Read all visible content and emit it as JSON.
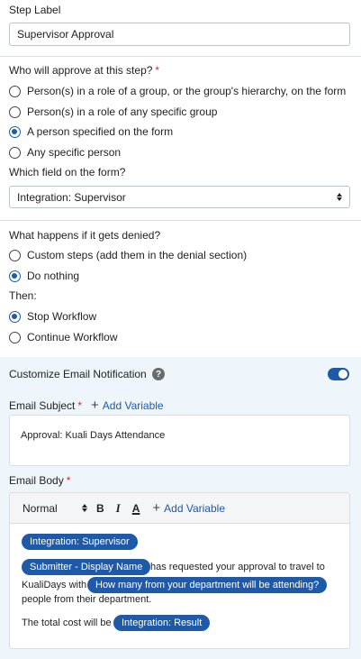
{
  "step_label": {
    "label": "Step Label",
    "value": "Supervisor Approval"
  },
  "approver": {
    "question": "Who will approve at this step?",
    "required_mark": "*",
    "options": [
      {
        "label": "Person(s) in a role of a group, or the group's hierarchy, on the form",
        "selected": false
      },
      {
        "label": "Person(s) in a role of any specific group",
        "selected": false
      },
      {
        "label": "A person specified on the form",
        "selected": true
      },
      {
        "label": "Any specific person",
        "selected": false
      }
    ],
    "field_question": "Which field on the form?",
    "field_value": "Integration: Supervisor"
  },
  "denial": {
    "question": "What happens if it gets denied?",
    "options": [
      {
        "label": "Custom steps (add them in the denial section)",
        "selected": false
      },
      {
        "label": "Do nothing",
        "selected": true
      }
    ],
    "then_label": "Then:",
    "then_options": [
      {
        "label": "Stop Workflow",
        "selected": true
      },
      {
        "label": "Continue Workflow",
        "selected": false
      }
    ]
  },
  "email": {
    "customize_label": "Customize Email Notification",
    "help_glyph": "?",
    "toggle_on": true,
    "subject_label": "Email Subject",
    "required_mark": "*",
    "add_variable": "Add Variable",
    "subject_value": "Approval: Kuali Days Attendance",
    "body_label": "Email Body",
    "toolbar": {
      "format": "Normal",
      "bold": "B",
      "italic": "I",
      "underline": "A",
      "add_variable": "Add Variable"
    },
    "body": {
      "pill_supervisor": "Integration: Supervisor",
      "period1": ".",
      "pill_submitter": "Submitter - Display Name",
      "text_requested": "has requested your approval to travel to",
      "text_kualidays": "KualiDays with",
      "pill_how_many": "How many from your department will be attending?",
      "text_people": "people from their department.",
      "text_total": "The total cost will be",
      "pill_result": "Integration: Result"
    }
  },
  "colors": {
    "accent": "#1e5aa8",
    "required": "#d62e2e",
    "panel_bg": "#eef5fb"
  }
}
